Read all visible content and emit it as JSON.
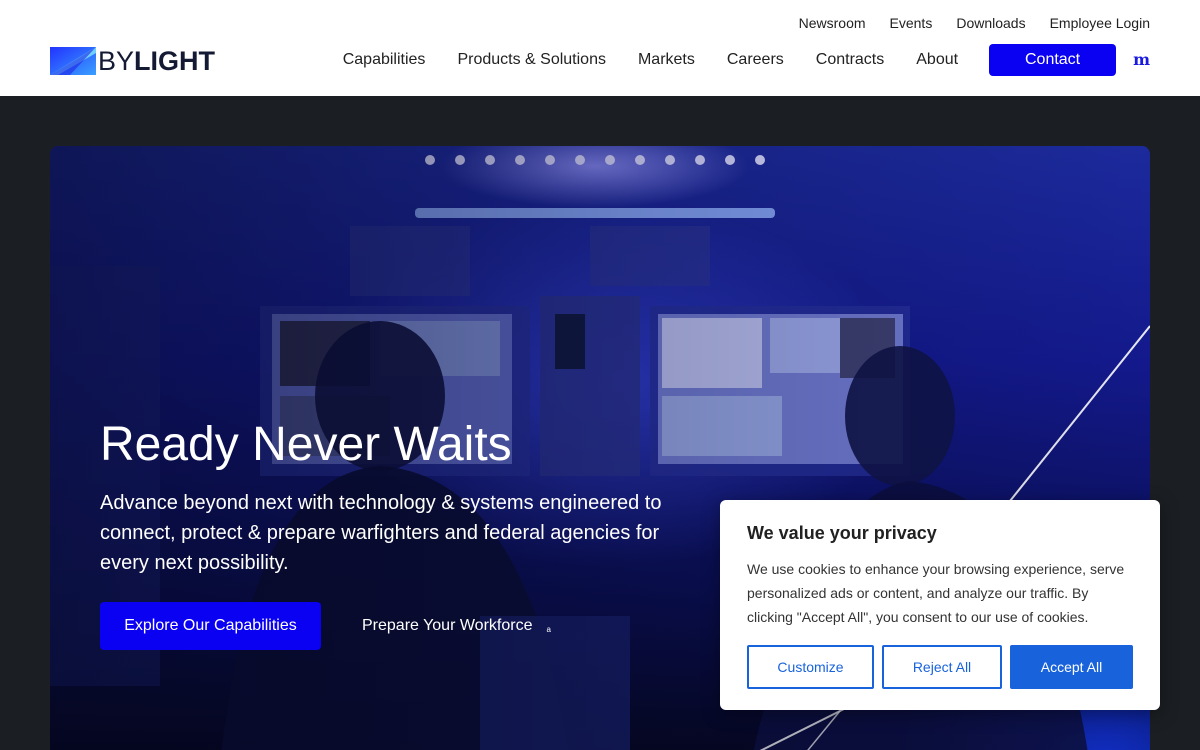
{
  "brand": {
    "logo_by": "BY",
    "logo_light": "LIGHT",
    "colors": {
      "primary": "#0a00f2",
      "navy": "#141a33",
      "cookie_accent": "#1863dc"
    }
  },
  "utility_nav": [
    "Newsroom",
    "Events",
    "Downloads",
    "Employee Login"
  ],
  "main_nav": {
    "items": [
      "Capabilities",
      "Products & Solutions",
      "Markets",
      "Careers",
      "Contracts",
      "About"
    ],
    "contact_label": "Contact",
    "menu_glyph": "m"
  },
  "hero": {
    "title": "Ready Never Waits",
    "subtitle": "Advance beyond next with technology & systems engineered to connect, protect & prepare warfighters and federal agencies for every next possibility.",
    "primary_cta": "Explore Our Capabilities",
    "secondary_cta": "Prepare Your Workforce",
    "secondary_glyph": "a"
  },
  "cookie_banner": {
    "title": "We value your privacy",
    "body": "We use cookies to enhance your browsing experience, serve personalized ads or content, and analyze our traffic. By clicking \"Accept All\", you consent to our use of cookies.",
    "customize_label": "Customize",
    "reject_label": "Reject All",
    "accept_label": "Accept All"
  },
  "icons": [
    "bylight-logo-mark-icon",
    "arrow-right-icon",
    "menu-icon"
  ]
}
